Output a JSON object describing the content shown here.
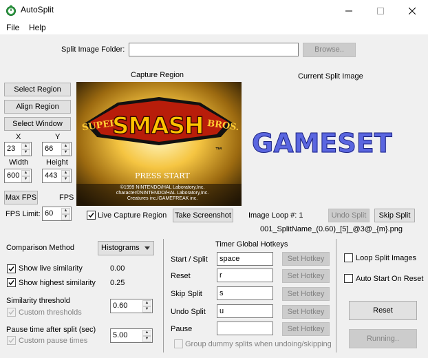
{
  "window": {
    "title": "AutoSplit"
  },
  "menu": {
    "file": "File",
    "help": "Help"
  },
  "split_folder": {
    "label": "Split Image Folder:",
    "value": "",
    "browse": "Browse.."
  },
  "capture": {
    "title": "Capture Region",
    "game_logo": "SMASH",
    "super": "SUPER",
    "bros": "BROS.",
    "press_start": "PRESS START",
    "copyright": [
      "©1999 NINTENDO/HAL Laboratory,Inc.",
      "character©NINTENDO/HAL Laboratory,Inc.",
      "Creatures inc./GAMEFREAK inc."
    ],
    "live_label": "Live Capture Region",
    "live_checked": true,
    "screenshot": "Take Screenshot"
  },
  "left_buttons": {
    "select_region": "Select Region",
    "align_region": "Align Region",
    "select_window": "Select Window"
  },
  "region": {
    "x_label": "X",
    "y_label": "Y",
    "x": "23",
    "y": "66",
    "width_label": "Width",
    "height_label": "Height",
    "width": "600",
    "height": "443"
  },
  "fps": {
    "max_button": "Max FPS",
    "fps_label": "FPS",
    "limit_label": "FPS Limit:",
    "limit": "60"
  },
  "current_split": {
    "title": "Current Split Image",
    "image_text": "GAMESET",
    "loop_label": "Image Loop #: 1",
    "undo": "Undo Split",
    "skip": "Skip Split",
    "filename": "001_SplitName_(0.60)_[5]_@3@_{m}.png"
  },
  "comparison": {
    "label": "Comparison Method",
    "value": "Histograms",
    "show_live_label": "Show live similarity",
    "show_live_value": "0.00",
    "show_live_checked": true,
    "show_high_label": "Show highest similarity",
    "show_high_value": "0.25",
    "show_high_checked": true,
    "threshold_label": "Similarity threshold",
    "custom_thresholds": "Custom thresholds",
    "threshold": "0.60",
    "pause_label": "Pause time after split (sec)",
    "custom_pause": "Custom pause times",
    "pause": "5.00"
  },
  "hotkeys": {
    "title": "Timer Global Hotkeys",
    "set_label": "Set Hotkey",
    "rows": [
      {
        "label": "Start / Split",
        "value": "space"
      },
      {
        "label": "Reset",
        "value": "r"
      },
      {
        "label": "Skip Split",
        "value": "s"
      },
      {
        "label": "Undo Split",
        "value": "u"
      },
      {
        "label": "Pause",
        "value": ""
      }
    ],
    "group_dummy": "Group dummy splits when undoing/skipping"
  },
  "right_panel": {
    "loop_split": "Loop Split Images",
    "auto_start": "Auto Start On Reset",
    "reset": "Reset",
    "running": "Running.."
  }
}
